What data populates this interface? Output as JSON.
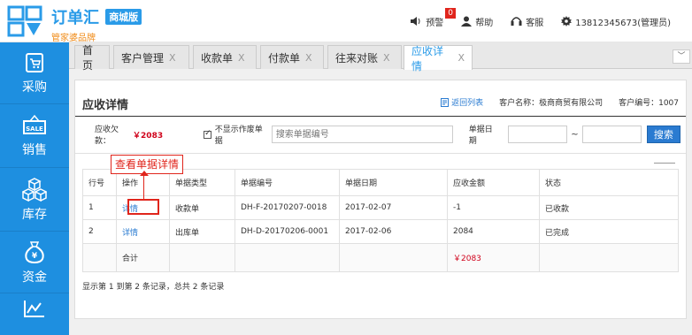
{
  "brand": {
    "title": "订单汇",
    "badge": "商城版",
    "subtitle": "管家婆品牌"
  },
  "topnav": {
    "alert_label": "预警",
    "alert_count": "0",
    "help_label": "帮助",
    "service_label": "客服",
    "user_label": "13812345673(管理员)"
  },
  "sidebar": {
    "items": [
      {
        "label": "采购",
        "icon": "cart-icon"
      },
      {
        "label": "销售",
        "icon": "sale-tag-icon"
      },
      {
        "label": "库存",
        "icon": "boxes-icon"
      },
      {
        "label": "资金",
        "icon": "money-bag-icon"
      },
      {
        "label": "",
        "icon": "chart-icon"
      }
    ]
  },
  "tabs": [
    {
      "label": "首页",
      "closable": false
    },
    {
      "label": "客户管理",
      "closable": true
    },
    {
      "label": "收款单",
      "closable": true
    },
    {
      "label": "付款单",
      "closable": true
    },
    {
      "label": "往来对账",
      "closable": true
    },
    {
      "label": "应收详情",
      "closable": true,
      "active": true
    }
  ],
  "tab_close_glyph": "X",
  "tab_collapse_glyph": "﹀",
  "page": {
    "title": "应收详情",
    "back_label": "返回列表",
    "customer_name": "客户名称：极商商贸有限公司",
    "customer_no": "客户编号：1007"
  },
  "filter": {
    "owe_label": "应收欠款：",
    "owe_value": "￥2083",
    "hide_voided_label": "不显示作废单据",
    "search_placeholder": "搜索单据编号",
    "date_label": "单据日期",
    "tilde": "~",
    "search_button": "搜索"
  },
  "tooltip": {
    "text": "查看单据详情"
  },
  "table": {
    "headers": [
      "行号",
      "操作",
      "单据类型",
      "单据编号",
      "单据日期",
      "应收金额",
      "状态"
    ],
    "rows": [
      {
        "no": "1",
        "action": "详情",
        "type": "收款单",
        "code": "DH-F-20170207-0018",
        "date": "2017-02-07",
        "amount": "-1",
        "status": "已收款"
      },
      {
        "no": "2",
        "action": "详情",
        "type": "出库单",
        "code": "DH-D-20170206-0001",
        "date": "2017-02-06",
        "amount": "2084",
        "status": "已完成"
      }
    ],
    "total": {
      "label": "合计",
      "amount": "￥2083"
    }
  },
  "footer": {
    "summary": "显示第 1 到第 2 条记录，总共 2 条记录"
  },
  "colors": {
    "primary": "#2a9be8",
    "sidebar": "#1e8fe0",
    "accent_red": "#e0251c",
    "link": "#2a7bd1",
    "brand_orange": "#f08c1a"
  }
}
